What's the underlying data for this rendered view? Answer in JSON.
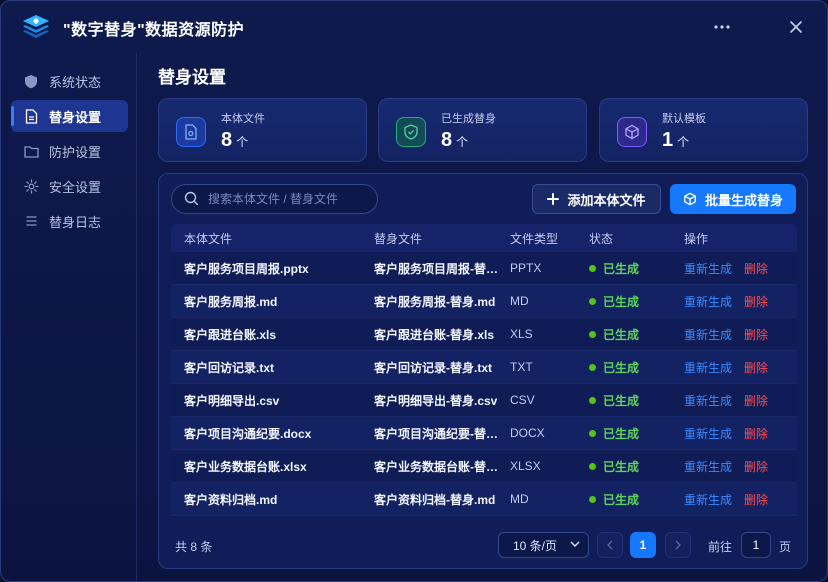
{
  "app": {
    "title": "\"数字替身\"数据资源防护"
  },
  "sidebar": {
    "items": [
      {
        "label": "系统状态",
        "icon": "shield-icon"
      },
      {
        "label": "替身设置",
        "icon": "file-icon",
        "active": true
      },
      {
        "label": "防护设置",
        "icon": "folder-icon"
      },
      {
        "label": "安全设置",
        "icon": "gear-icon"
      },
      {
        "label": "替身日志",
        "icon": "list-icon"
      }
    ]
  },
  "page": {
    "title": "替身设置"
  },
  "stats": [
    {
      "label": "本体文件",
      "value": "8",
      "unit": "个",
      "icon": "file-icon",
      "accent": "#2b6cff"
    },
    {
      "label": "已生成替身",
      "value": "8",
      "unit": "个",
      "icon": "shield-check-icon",
      "accent": "#19b27a"
    },
    {
      "label": "默认模板",
      "value": "1",
      "unit": "个",
      "icon": "cube-icon",
      "accent": "#7a5cff"
    }
  ],
  "toolbar": {
    "search_placeholder": "搜索本体文件 / 替身文件",
    "add_label": "添加本体文件",
    "batch_label": "批量生成替身"
  },
  "table": {
    "headers": [
      "本体文件",
      "替身文件",
      "文件类型",
      "状态",
      "操作"
    ],
    "rows": [
      {
        "source": "客户服务项目周报.pptx",
        "replica": "客户服务项目周报-替…",
        "type": "PPTX",
        "status": "已生成"
      },
      {
        "source": "客户服务周报.md",
        "replica": "客户服务周报-替身.md",
        "type": "MD",
        "status": "已生成"
      },
      {
        "source": "客户跟进台账.xls",
        "replica": "客户跟进台账-替身.xls",
        "type": "XLS",
        "status": "已生成"
      },
      {
        "source": "客户回访记录.txt",
        "replica": "客户回访记录-替身.txt",
        "type": "TXT",
        "status": "已生成"
      },
      {
        "source": "客户明细导出.csv",
        "replica": "客户明细导出-替身.csv",
        "type": "CSV",
        "status": "已生成"
      },
      {
        "source": "客户项目沟通纪要.docx",
        "replica": "客户项目沟通纪要-替…",
        "type": "DOCX",
        "status": "已生成"
      },
      {
        "source": "客户业务数据台账.xlsx",
        "replica": "客户业务数据台账-替…",
        "type": "XLSX",
        "status": "已生成"
      },
      {
        "source": "客户资料归档.md",
        "replica": "客户资料归档-替身.md",
        "type": "MD",
        "status": "已生成"
      }
    ],
    "action_regen": "重新生成",
    "action_delete": "删除"
  },
  "pagination": {
    "total": "共 8 条",
    "page_size": "10 条/页",
    "current_page": "1",
    "goto_label": "前往",
    "goto_value": "1",
    "goto_suffix": "页"
  }
}
